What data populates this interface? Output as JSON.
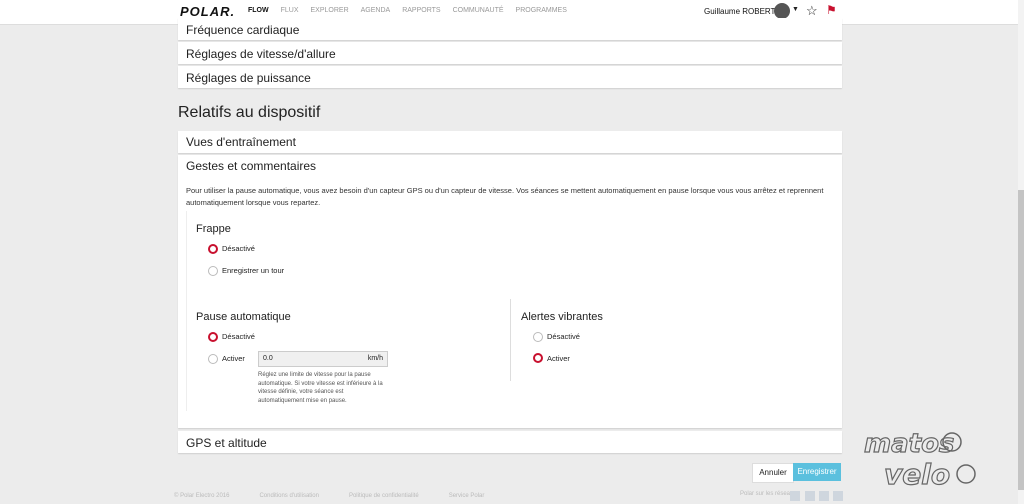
{
  "header": {
    "logo": "POLAR.",
    "nav": [
      "FLOW",
      "FLUX",
      "EXPLORER",
      "AGENDA",
      "RAPPORTS",
      "COMMUNAUTÉ",
      "PROGRAMMES"
    ],
    "user": "Guillaume ROBERT",
    "star_icon": "☆",
    "flag_icon": "⚑"
  },
  "accordions_top": [
    "Fréquence cardiaque",
    "Réglages de vitesse/d'allure",
    "Réglages de puissance"
  ],
  "section_title": "Relatifs au dispositif",
  "views_panel": "Vues d'entraînement",
  "gestures": {
    "title": "Gestes et commentaires",
    "description": "Pour utiliser la pause automatique, vous avez besoin d'un capteur GPS ou d'un capteur de vitesse. Vos séances se mettent automatiquement en pause lorsque vous vous arrêtez et reprennent automatiquement lorsque vous repartez.",
    "frappe": {
      "title": "Frappe",
      "options": [
        "Désactivé",
        "Enregistrer un tour"
      ],
      "selected": 0
    },
    "pause": {
      "title": "Pause automatique",
      "options": [
        "Désactivé",
        "Activer"
      ],
      "selected": 0,
      "speed_value": "0.0",
      "speed_unit": "km/h",
      "hint": "Réglez une limite de vitesse pour la pause automatique. Si votre vitesse est inférieure à la vitesse définie, votre séance est automatiquement mise en pause."
    },
    "vibrate": {
      "title": "Alertes vibrantes",
      "options": [
        "Désactivé",
        "Activer"
      ],
      "selected": 1
    }
  },
  "gps_panel": "GPS et altitude",
  "buttons": {
    "cancel": "Annuler",
    "save": "Enregistrer"
  },
  "footer": [
    "© Polar Electro 2016",
    "Conditions d'utilisation",
    "Politique de confidentialité",
    "Service Polar"
  ],
  "social_label": "Polar sur les réseaux",
  "colors": {
    "accent": "#c8102e",
    "save": "#5bc0de"
  },
  "watermark": "matos velo"
}
